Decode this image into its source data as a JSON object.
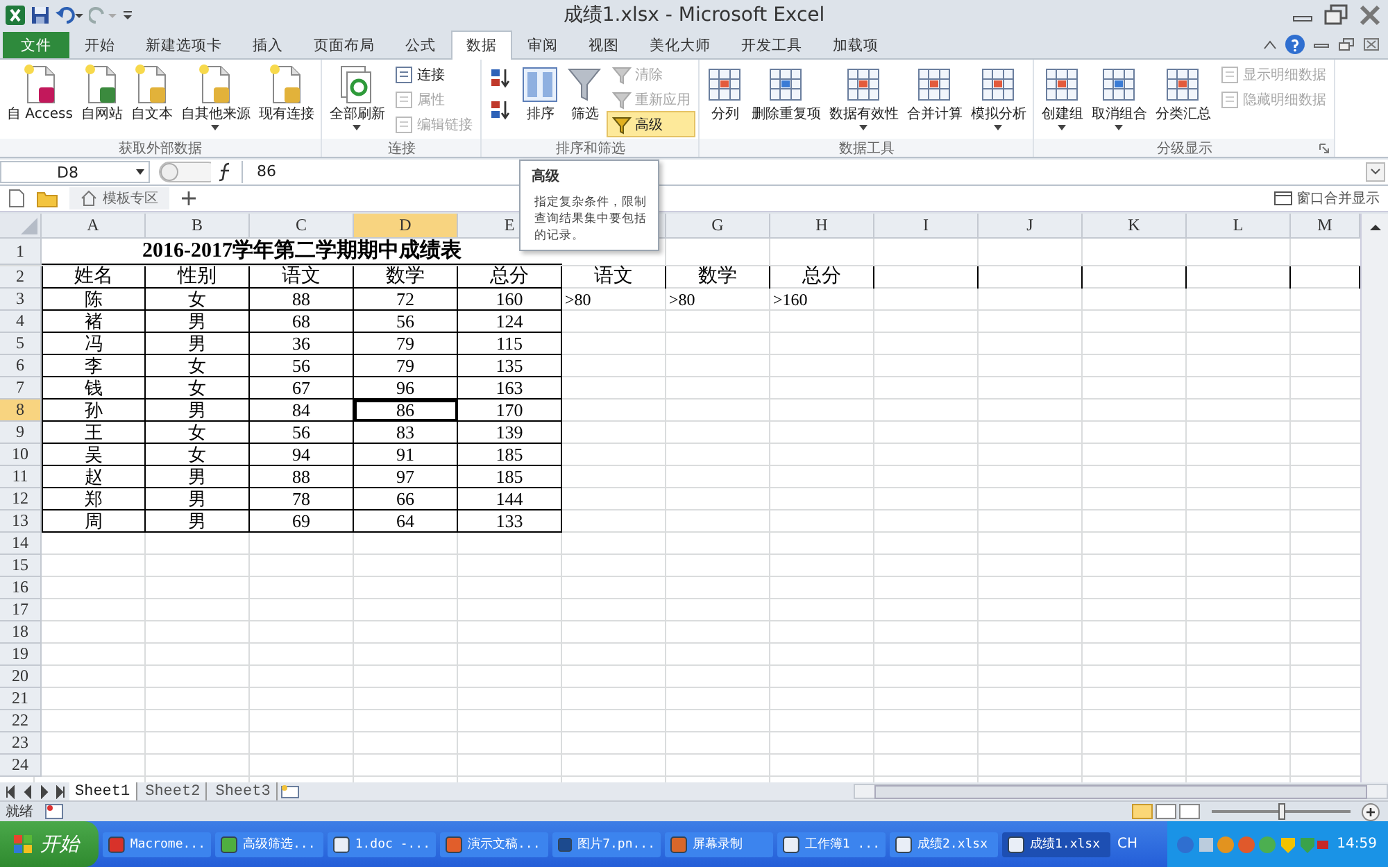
{
  "window": {
    "title": "成绩1.xlsx - Microsoft Excel"
  },
  "ribbon_tabs": [
    {
      "label": "文件",
      "kind": "file",
      "selected": false
    },
    {
      "label": "开始",
      "kind": "tab",
      "selected": false
    },
    {
      "label": "新建选项卡",
      "kind": "tab",
      "selected": false
    },
    {
      "label": "插入",
      "kind": "tab",
      "selected": false
    },
    {
      "label": "页面布局",
      "kind": "tab",
      "selected": false
    },
    {
      "label": "公式",
      "kind": "tab",
      "selected": false
    },
    {
      "label": "数据",
      "kind": "tab",
      "selected": true
    },
    {
      "label": "审阅",
      "kind": "tab",
      "selected": false
    },
    {
      "label": "视图",
      "kind": "tab",
      "selected": false
    },
    {
      "label": "美化大师",
      "kind": "tab",
      "selected": false
    },
    {
      "label": "开发工具",
      "kind": "tab",
      "selected": false
    },
    {
      "label": "加载项",
      "kind": "tab",
      "selected": false
    }
  ],
  "ribbon_groups": [
    {
      "label": "获取外部数据",
      "launcher": false,
      "buttons": [
        {
          "label": "自 Access",
          "kind": "large",
          "dropdown": false,
          "disabled": false,
          "hovered": false
        },
        {
          "label": "自网站",
          "kind": "large",
          "dropdown": false,
          "disabled": false,
          "hovered": false
        },
        {
          "label": "自文本",
          "kind": "large",
          "dropdown": false,
          "disabled": false,
          "hovered": false
        },
        {
          "label": "自其他来源",
          "kind": "large",
          "dropdown": true,
          "disabled": false,
          "hovered": false
        },
        {
          "label": "现有连接",
          "kind": "large",
          "dropdown": false,
          "disabled": false,
          "hovered": false
        }
      ]
    },
    {
      "label": "连接",
      "launcher": false,
      "buttons": [
        {
          "label": "全部刷新",
          "kind": "large",
          "dropdown": true,
          "disabled": false,
          "hovered": false
        },
        {
          "label": "连接",
          "kind": "small",
          "dropdown": false,
          "disabled": false,
          "hovered": false
        },
        {
          "label": "属性",
          "kind": "small",
          "dropdown": false,
          "disabled": true,
          "hovered": false
        },
        {
          "label": "编辑链接",
          "kind": "small",
          "dropdown": false,
          "disabled": true,
          "hovered": false
        }
      ]
    },
    {
      "label": "排序和筛选",
      "launcher": false,
      "buttons": [
        {
          "kind": "icon",
          "dropdown": false,
          "disabled": false,
          "hovered": false
        },
        {
          "kind": "icon",
          "dropdown": false,
          "disabled": false,
          "hovered": false
        },
        {
          "label": "排序",
          "kind": "large",
          "dropdown": false,
          "disabled": false,
          "hovered": false
        },
        {
          "label": "筛选",
          "kind": "large",
          "dropdown": false,
          "disabled": false,
          "hovered": false
        },
        {
          "label": "清除",
          "kind": "small",
          "dropdown": false,
          "disabled": true,
          "hovered": false
        },
        {
          "label": "重新应用",
          "kind": "small",
          "dropdown": false,
          "disabled": true,
          "hovered": false
        },
        {
          "label": "高级",
          "kind": "small",
          "dropdown": false,
          "disabled": false,
          "hovered": true
        }
      ]
    },
    {
      "label": "数据工具",
      "launcher": false,
      "buttons": [
        {
          "label": "分列",
          "kind": "large",
          "dropdown": false,
          "disabled": false,
          "hovered": false
        },
        {
          "label": "删除重复项",
          "kind": "large",
          "dropdown": false,
          "disabled": false,
          "hovered": false
        },
        {
          "label": "数据有效性",
          "kind": "large",
          "dropdown": true,
          "disabled": false,
          "hovered": false
        },
        {
          "label": "合并计算",
          "kind": "large",
          "dropdown": false,
          "disabled": false,
          "hovered": false
        },
        {
          "label": "模拟分析",
          "kind": "large",
          "dropdown": true,
          "disabled": false,
          "hovered": false
        }
      ]
    },
    {
      "label": "分级显示",
      "launcher": true,
      "buttons": [
        {
          "label": "创建组",
          "kind": "large",
          "dropdown": true,
          "disabled": false,
          "hovered": false
        },
        {
          "label": "取消组合",
          "kind": "large",
          "dropdown": true,
          "disabled": false,
          "hovered": false
        },
        {
          "label": "分类汇总",
          "kind": "large",
          "dropdown": false,
          "disabled": false,
          "hovered": false
        },
        {
          "label": "显示明细数据",
          "kind": "small",
          "dropdown": false,
          "disabled": true,
          "hovered": false
        },
        {
          "label": "隐藏明细数据",
          "kind": "small",
          "dropdown": false,
          "disabled": true,
          "hovered": false
        }
      ]
    }
  ],
  "tooltip": {
    "title": "高级",
    "text": "指定复杂条件，限制查询结果集中要包括的记录。"
  },
  "formula_bar": {
    "name_box": "D8",
    "value": "86"
  },
  "doc_tabs": {
    "tab": "模板专区",
    "merge_windows": "窗口合并显示"
  },
  "columns": [
    {
      "label": "A",
      "selected": false
    },
    {
      "label": "B",
      "selected": false
    },
    {
      "label": "C",
      "selected": false
    },
    {
      "label": "D",
      "selected": true
    },
    {
      "label": "E",
      "selected": false
    },
    {
      "selected": false
    },
    {
      "label": "G",
      "selected": false
    },
    {
      "label": "H",
      "selected": false
    },
    {
      "label": "I",
      "selected": false
    },
    {
      "label": "J",
      "selected": false
    },
    {
      "label": "K",
      "selected": false
    },
    {
      "label": "L",
      "selected": false
    },
    {
      "label": "M",
      "selected": false
    }
  ],
  "rows": [
    {
      "header": "1",
      "kind": "title",
      "selected": false,
      "cells": [
        "2016-2017学年第二学期期中成绩表"
      ]
    },
    {
      "header": "2",
      "kind": "head",
      "selected": false,
      "cells": [
        "姓名",
        "性别",
        "语文",
        "数学",
        "总分",
        "语文",
        "数学",
        "总分"
      ]
    },
    {
      "header": "3",
      "kind": "body",
      "selected": false,
      "cells": [
        "陈",
        "女",
        "88",
        "72",
        "160",
        ">80",
        ">80",
        ">160"
      ]
    },
    {
      "header": "4",
      "kind": "body",
      "selected": false,
      "cells": [
        "褚",
        "男",
        "68",
        "56",
        "124"
      ]
    },
    {
      "header": "5",
      "kind": "body",
      "selected": false,
      "cells": [
        "冯",
        "男",
        "36",
        "79",
        "115"
      ]
    },
    {
      "header": "6",
      "kind": "body",
      "selected": false,
      "cells": [
        "李",
        "女",
        "56",
        "79",
        "135"
      ]
    },
    {
      "header": "7",
      "kind": "body",
      "selected": false,
      "cells": [
        "钱",
        "女",
        "67",
        "96",
        "163"
      ]
    },
    {
      "header": "8",
      "kind": "body",
      "selected": true,
      "cells": [
        "孙",
        "男",
        "84",
        "86",
        "170"
      ]
    },
    {
      "header": "9",
      "kind": "body",
      "selected": false,
      "cells": [
        "王",
        "女",
        "56",
        "83",
        "139"
      ]
    },
    {
      "header": "10",
      "kind": "body",
      "selected": false,
      "cells": [
        "吴",
        "女",
        "94",
        "91",
        "185"
      ]
    },
    {
      "header": "11",
      "kind": "body",
      "selected": false,
      "cells": [
        "赵",
        "男",
        "88",
        "97",
        "185"
      ]
    },
    {
      "header": "12",
      "kind": "body",
      "selected": false,
      "cells": [
        "郑",
        "男",
        "78",
        "66",
        "144"
      ]
    },
    {
      "header": "13",
      "kind": "body",
      "selected": false,
      "cells": [
        "周",
        "男",
        "69",
        "64",
        "133"
      ]
    },
    {
      "header": "14",
      "kind": "empty",
      "selected": false
    },
    {
      "header": "15",
      "kind": "empty",
      "selected": false
    },
    {
      "header": "16",
      "kind": "empty",
      "selected": false
    },
    {
      "header": "17",
      "kind": "empty",
      "selected": false
    },
    {
      "header": "18",
      "kind": "empty",
      "selected": false
    },
    {
      "header": "19",
      "kind": "empty",
      "selected": false
    },
    {
      "header": "20",
      "kind": "empty",
      "selected": false
    },
    {
      "header": "21",
      "kind": "empty",
      "selected": false
    },
    {
      "header": "22",
      "kind": "empty",
      "selected": false
    },
    {
      "header": "23",
      "kind": "empty",
      "selected": false
    },
    {
      "header": "24",
      "kind": "empty",
      "selected": false
    }
  ],
  "sheet_tabs": [
    {
      "label": "Sheet1",
      "selected": true
    },
    {
      "label": "Sheet2",
      "selected": false
    },
    {
      "label": "Sheet3",
      "selected": false
    }
  ],
  "status_bar": {
    "status": "就绪",
    "zoom": {
      "level": 0.5
    }
  },
  "taskbar": {
    "start": "开始",
    "items": [
      {
        "label": "Macrome...",
        "selected": false
      },
      {
        "label": "高级筛选...",
        "selected": false
      },
      {
        "label": "1.doc -...",
        "selected": false
      },
      {
        "label": "演示文稿...",
        "selected": false
      },
      {
        "label": "图片7.pn...",
        "selected": false
      },
      {
        "label": "屏幕录制",
        "selected": false
      },
      {
        "label": "工作簿1 ...",
        "selected": false
      },
      {
        "label": "成绩2.xlsx",
        "selected": false
      },
      {
        "label": "成绩1.xlsx",
        "selected": true
      }
    ],
    "language": "CH",
    "clock": "14:59"
  }
}
